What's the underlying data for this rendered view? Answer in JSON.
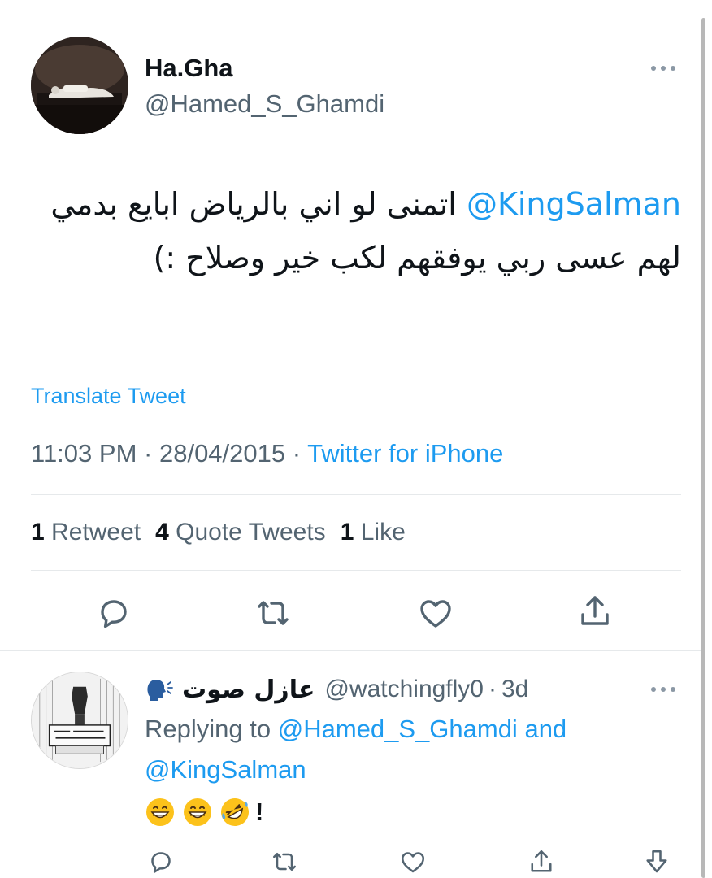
{
  "main_tweet": {
    "display_name": "Ha.Gha",
    "handle": "@Hamed_S_Ghamdi",
    "mention": "@KingSalman",
    "text": "اتمنى لو اني بالرياض ابايع بدمي لهم عسى ربي يوفقهم لكب خير وصلاح :)",
    "translate_label": "Translate Tweet",
    "time": "11:03 PM",
    "separator": "·",
    "date": "28/04/2015",
    "source": "Twitter for iPhone",
    "stats": {
      "retweets_count": "1",
      "retweets_label": "Retweet",
      "quotes_count": "4",
      "quotes_label": "Quote Tweets",
      "likes_count": "1",
      "likes_label": "Like"
    },
    "actions": [
      "reply-icon",
      "retweet-icon",
      "like-icon",
      "share-icon"
    ]
  },
  "reply": {
    "display_name": "عازل صوت",
    "name_icon": "speaking-head-icon",
    "handle": "@watchingfly0",
    "separator": "·",
    "time": "3d",
    "replying_prefix": "Replying to",
    "replying_to_1": "@Hamed_S_Ghamdi",
    "replying_and": "and",
    "replying_to_2": "@KingSalman",
    "emojis": [
      "grinning-face-icon",
      "grinning-face-icon",
      "rofl-face-icon"
    ],
    "text_suffix": "!",
    "actions": [
      "reply-icon",
      "retweet-icon",
      "like-icon",
      "share-icon",
      "downvote-icon"
    ]
  },
  "colors": {
    "accent": "#1d9bf0",
    "secondary_text": "#536471",
    "primary_text": "#0f1419",
    "divider": "#e6e9eb"
  }
}
